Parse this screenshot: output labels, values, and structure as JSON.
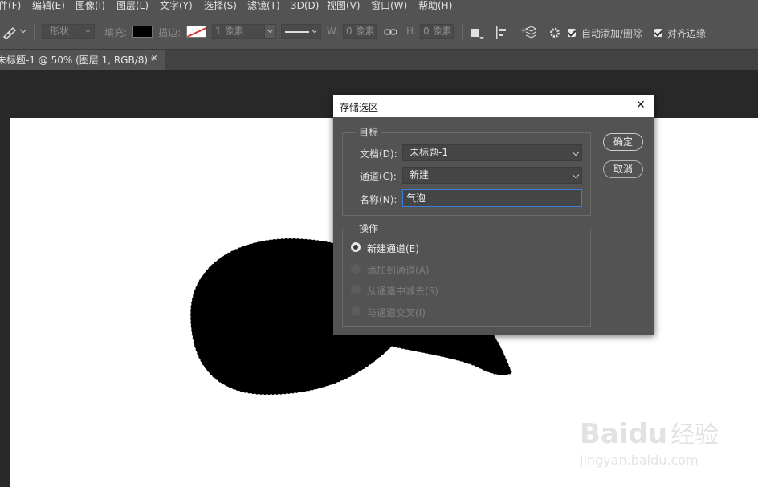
{
  "menubar": {
    "items": [
      "件(F)",
      "编辑(E)",
      "图像(I)",
      "图层(L)",
      "文字(Y)",
      "选择(S)",
      "滤镜(T)",
      "3D(D)",
      "视图(V)",
      "窗口(W)",
      "帮助(H)"
    ]
  },
  "options": {
    "mode_value": "形状",
    "fill_label": "填充:",
    "stroke_label": "描边:",
    "stroke_width_value": "1 像素",
    "w_label": "W:",
    "w_value": "0 像素",
    "h_label": "H:",
    "h_value": "0 像素",
    "auto_add_label": "自动添加/删除",
    "align_edges_label": "对齐边缘"
  },
  "tab": {
    "title": "未标题-1 @ 50% (图层 1, RGB/8) *",
    "close": "×"
  },
  "dialog": {
    "title": "存储选区",
    "close": "✕",
    "target_legend": "目标",
    "doc_label": "文档(D):",
    "doc_value": "未标题-1",
    "channel_label": "通道(C):",
    "channel_value": "新建",
    "name_label": "名称(N):",
    "name_value": "气泡",
    "operation_legend": "操作",
    "ops": [
      {
        "label": "新建通道(E)",
        "selected": true,
        "enabled": true
      },
      {
        "label": "添加到通道(A)",
        "selected": false,
        "enabled": false
      },
      {
        "label": "从通道中减去(S)",
        "selected": false,
        "enabled": false
      },
      {
        "label": "与通道交叉(I)",
        "selected": false,
        "enabled": false
      }
    ],
    "ok": "确定",
    "cancel": "取消"
  },
  "watermark": {
    "brand": "Bai",
    "paw": "du",
    "cn": "经验",
    "url": "jingyan.baidu.com"
  },
  "colors": {
    "panel": "#535353",
    "workspace": "#282828",
    "canvas": "#ffffff",
    "accent_focus": "#3b7fd4"
  }
}
